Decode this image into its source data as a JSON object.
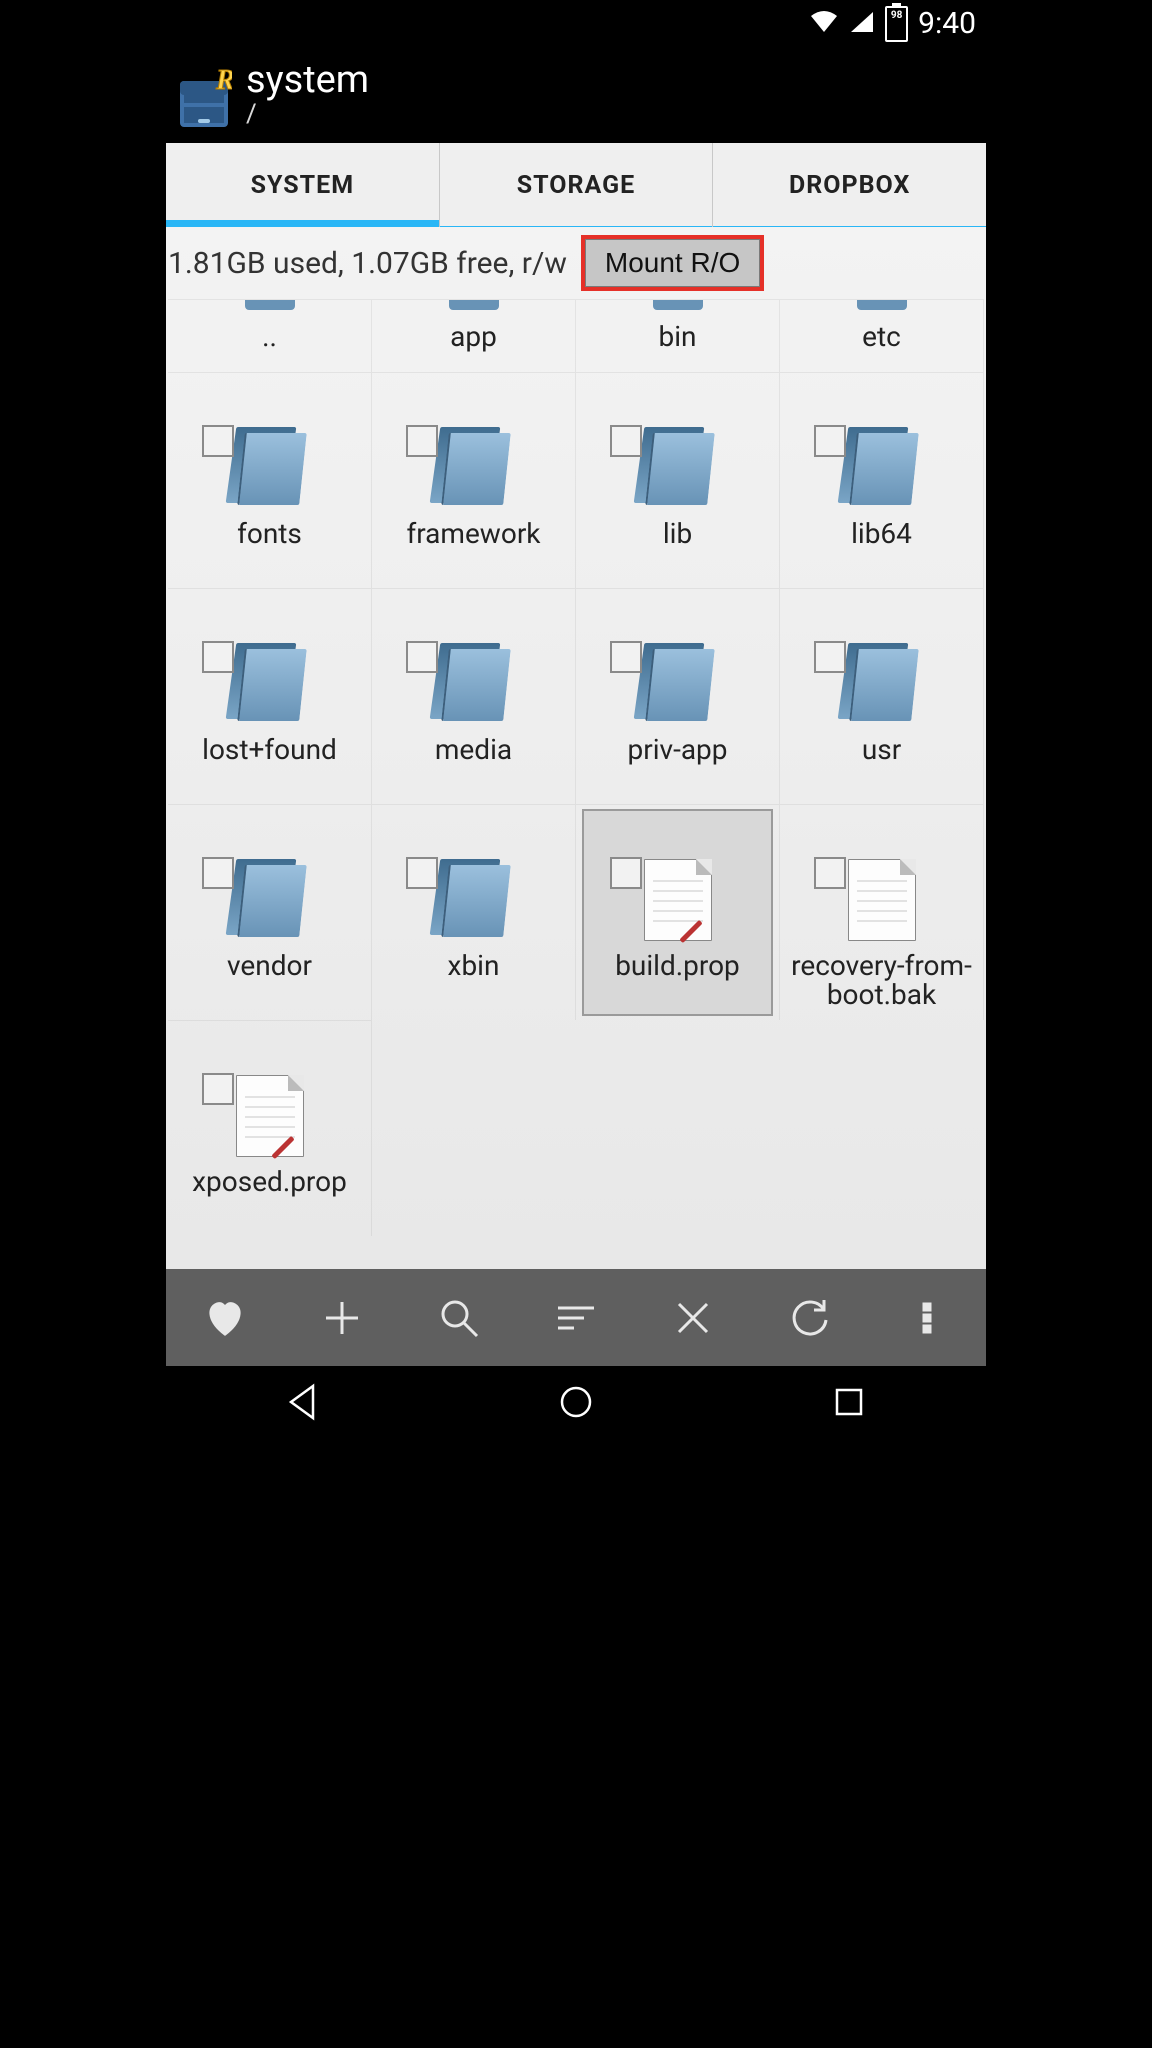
{
  "statusbar": {
    "battery_pct": "98",
    "time": "9:40"
  },
  "header": {
    "title": "system",
    "path": "/"
  },
  "tabs": [
    {
      "label": "SYSTEM",
      "active": true
    },
    {
      "label": "STORAGE",
      "active": false
    },
    {
      "label": "DROPBOX",
      "active": false
    }
  ],
  "storage": {
    "stats": "1.81GB used, 1.07GB free, r/w",
    "mount_label": "Mount R/O"
  },
  "items": [
    {
      "name": "..",
      "type": "folder",
      "row": 0
    },
    {
      "name": "app",
      "type": "folder",
      "row": 0
    },
    {
      "name": "bin",
      "type": "folder",
      "row": 0
    },
    {
      "name": "etc",
      "type": "folder",
      "row": 0
    },
    {
      "name": "fonts",
      "type": "folder",
      "row": 1
    },
    {
      "name": "framework",
      "type": "folder",
      "row": 1
    },
    {
      "name": "lib",
      "type": "folder",
      "row": 1
    },
    {
      "name": "lib64",
      "type": "folder",
      "row": 1
    },
    {
      "name": "lost+found",
      "type": "folder",
      "row": 2
    },
    {
      "name": "media",
      "type": "folder",
      "row": 2
    },
    {
      "name": "priv-app",
      "type": "folder",
      "row": 2
    },
    {
      "name": "usr",
      "type": "folder",
      "row": 2
    },
    {
      "name": "vendor",
      "type": "folder",
      "row": 3
    },
    {
      "name": "xbin",
      "type": "folder",
      "row": 3
    },
    {
      "name": "build.prop",
      "type": "file-edit",
      "row": 3,
      "selected": true
    },
    {
      "name": "recovery-from-boot.bak",
      "type": "file",
      "row": 3
    },
    {
      "name": "xposed.prop",
      "type": "file-edit",
      "row": 4
    }
  ],
  "toolbar": {
    "favorites": "Favorites",
    "add": "Add",
    "search": "Search",
    "sort": "Sort",
    "close": "Close",
    "refresh": "Refresh",
    "more": "More"
  },
  "nav": {
    "back": "Back",
    "home": "Home",
    "recent": "Recent"
  }
}
